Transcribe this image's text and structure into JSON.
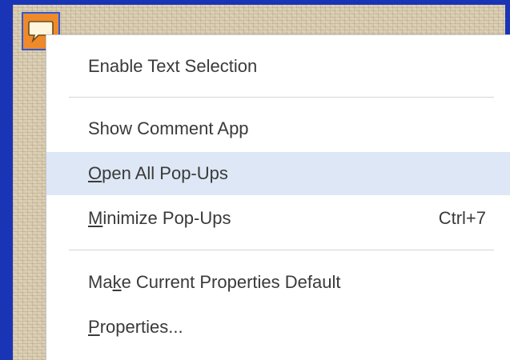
{
  "menu": {
    "items": [
      {
        "label": "Enable Text Selection",
        "shortcut": ""
      },
      {
        "label": "Show Comment App",
        "shortcut": ""
      },
      {
        "label_pre": "",
        "label_key": "O",
        "label_post": "pen All Pop-Ups",
        "shortcut": ""
      },
      {
        "label_pre": "",
        "label_key": "M",
        "label_post": "inimize Pop-Ups",
        "shortcut": "Ctrl+7"
      },
      {
        "label_pre": "Ma",
        "label_key": "k",
        "label_post": "e Current Properties Default",
        "shortcut": ""
      },
      {
        "label_pre": "",
        "label_key": "P",
        "label_post": "roperties...",
        "shortcut": ""
      }
    ]
  },
  "note_icon": {
    "name": "comment-note-icon",
    "color": "#ef8a2a"
  },
  "colors": {
    "background": "#1a34b6",
    "hover": "#dde7f5",
    "menu": "#ffffff"
  }
}
